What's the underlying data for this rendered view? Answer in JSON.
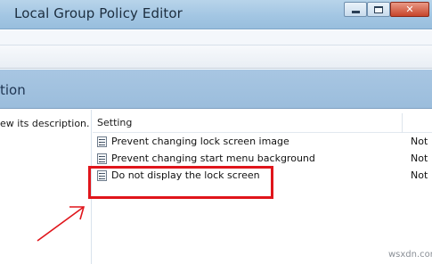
{
  "window": {
    "title": "Local Group Policy Editor",
    "buttons": {
      "minimize": "minimize-icon",
      "maximize": "maximize-icon",
      "close": "close-icon",
      "close_glyph": "✕"
    }
  },
  "header": {
    "text": "tion"
  },
  "description_pane": {
    "text": "ew its description."
  },
  "settings": {
    "column_header": "Setting",
    "rows": [
      {
        "label": "Prevent changing lock screen image",
        "state": "Not"
      },
      {
        "label": "Prevent changing start menu background",
        "state": "Not"
      },
      {
        "label": "Do not display the lock screen",
        "state": "Not"
      }
    ]
  },
  "annotation": {
    "color": "#e0151b",
    "highlighted_row": "Do not display the lock screen"
  },
  "watermark": "wsxdn.com"
}
